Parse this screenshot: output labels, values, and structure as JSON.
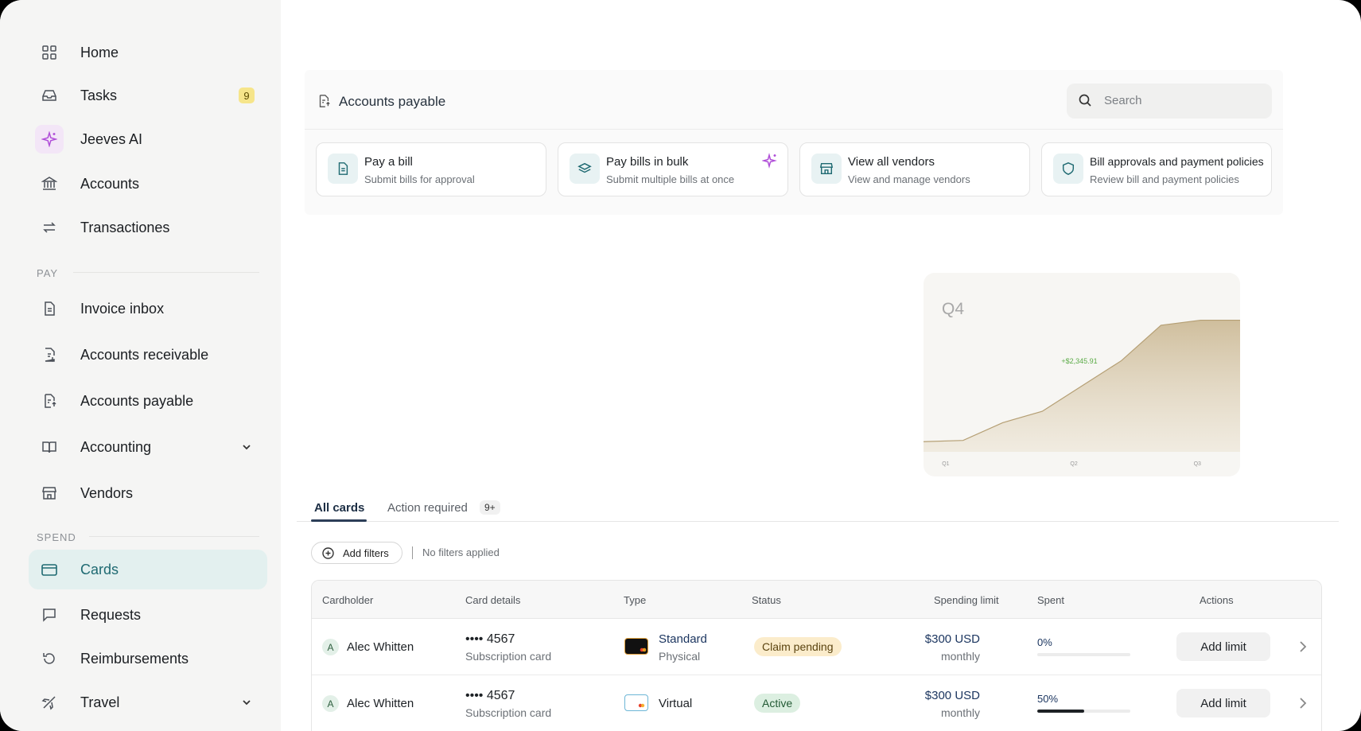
{
  "sidebar": {
    "items": [
      {
        "label": "Home",
        "icon": "grid-icon"
      },
      {
        "label": "Tasks",
        "icon": "inbox-icon",
        "badge": "9"
      },
      {
        "label": "Jeeves AI",
        "icon": "sparkle-icon"
      },
      {
        "label": "Accounts",
        "icon": "bank-icon"
      },
      {
        "label": "Transactiones",
        "icon": "transfer-icon"
      },
      {
        "label": "Invoice inbox",
        "icon": "document-icon"
      },
      {
        "label": "Accounts receivable",
        "icon": "receivable-icon"
      },
      {
        "label": "Accounts payable",
        "icon": "payable-icon"
      },
      {
        "label": "Accounting",
        "icon": "book-icon"
      },
      {
        "label": "Vendors",
        "icon": "store-icon"
      },
      {
        "label": "Cards",
        "icon": "card-icon"
      },
      {
        "label": "Requests",
        "icon": "message-icon"
      },
      {
        "label": "Reimbursements",
        "icon": "refresh-icon"
      },
      {
        "label": "Travel",
        "icon": "plane-icon"
      }
    ],
    "sections": {
      "pay": "PAY",
      "spend": "SPEND"
    },
    "active": "Cards"
  },
  "accounts_payable": {
    "title": "Accounts payable",
    "search_placeholder": "Search",
    "actions": [
      {
        "title": "Pay a bill",
        "subtitle": "Submit bills for approval",
        "icon": "document-icon"
      },
      {
        "title": "Pay bills in bulk",
        "subtitle": "Submit multiple bills at once",
        "icon": "layers-icon"
      },
      {
        "title": "View all vendors",
        "subtitle": "View and manage vendors",
        "icon": "store-icon"
      },
      {
        "title": "Bill approvals and payment policies",
        "subtitle": "Review bill and payment policies",
        "icon": "shield-icon"
      }
    ]
  },
  "chart_data": {
    "type": "area",
    "title": "Q4",
    "annotation": "+$2,345.91",
    "annotation_color": "#5bab47",
    "fill_color": "#cdbb98",
    "x": [
      "Q1",
      "",
      "",
      "",
      "Q2",
      "",
      "",
      "Q3",
      ""
    ],
    "xticks": [
      "Q1",
      "Q2",
      "Q3"
    ],
    "values": [
      8,
      9,
      23,
      32,
      52,
      72,
      100,
      104,
      104
    ],
    "ylim": [
      0,
      110
    ]
  },
  "tabs": [
    {
      "label": "All cards",
      "active": true
    },
    {
      "label": "Action required",
      "badge": "9+"
    }
  ],
  "filters": {
    "button": "Add filters",
    "status": "No filters applied"
  },
  "table": {
    "columns": [
      "Cardholder",
      "Card details",
      "Type",
      "Status",
      "Spending limit",
      "Spent",
      "Actions"
    ],
    "rows": [
      {
        "initial": "A",
        "name": "Alec Whitten",
        "card_number": "•••• 4567",
        "card_label": "Subscription card",
        "type": "Standard",
        "type_sub": "Physical",
        "status": "Claim pending",
        "limit": "$300 USD",
        "limit_period": "monthly",
        "spent": "0%",
        "spent_fraction": 0.0,
        "action": "Add limit"
      },
      {
        "initial": "A",
        "name": "Alec Whitten",
        "card_number": "•••• 4567",
        "card_label": "Subscription card",
        "type": "Virtual",
        "type_sub": "",
        "status": "Active",
        "limit": "$300 USD",
        "limit_period": "monthly",
        "spent": "50%",
        "spent_fraction": 0.5,
        "action": "Add limit"
      }
    ]
  },
  "colors": {
    "accent": "#1f6a72",
    "claim_pending_bg": "#fbeccb",
    "active_bg": "#dcefe1"
  }
}
